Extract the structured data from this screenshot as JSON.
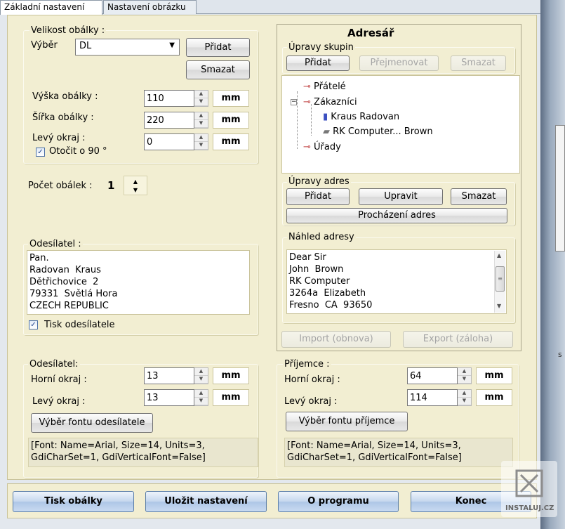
{
  "tabs": {
    "basic": "Základní nastavení",
    "image": "Nastavení obrázku"
  },
  "envelope_size": {
    "group_title": "Velikost obálky :",
    "select_label": "Výběr",
    "select_value": "DL",
    "add_button": "Přidat",
    "delete_button": "Smazat",
    "height_label": "Výška obálky :",
    "height_value": "110",
    "width_label": "Šířka obálky :",
    "width_value": "220",
    "left_margin_label": "Levý okraj :",
    "left_margin_value": "0",
    "unit": "mm",
    "rotate_label": "Otočit o 90 °"
  },
  "count": {
    "label": "Počet obálek :",
    "value": "1"
  },
  "sender": {
    "group_title": "Odesílatel :",
    "lines": "Pan.\nRadovan  Kraus\nDětřichovice  2\n79331  Světlá Hora\nCZECH REPUBLIC",
    "print_label": "Tisk odesílatele"
  },
  "address_book": {
    "title": "Adresář",
    "groups_title": "Úpravy skupin",
    "groups_add": "Přidat",
    "groups_rename": "Přejmenovat",
    "groups_delete": "Smazat",
    "tree": {
      "friends": "Přátelé",
      "customers": "Zákazníci",
      "contact1": "Kraus Radovan",
      "contact2": "RK Computer... Brown",
      "offices": "Úřady"
    },
    "addresses_title": "Úpravy adres",
    "addr_add": "Přidat",
    "addr_edit": "Upravit",
    "addr_delete": "Smazat",
    "browse": "Procházení adres",
    "preview_title": "Náhled adresy",
    "preview_text": "Dear Sir\nJohn  Brown\nRK Computer\n3264a  Elizabeth\nFresno  CA  93650",
    "import": "Import (obnova)",
    "export": "Export (záloha)"
  },
  "sender_font": {
    "group_title": "Odesílatel:",
    "top_label": "Horní okraj :",
    "top_value": "13",
    "left_label": "Levý okraj :",
    "left_value": "13",
    "unit": "mm",
    "font_button": "Výběr fontu odesílatele",
    "font_info": "[Font: Name=Arial, Size=14, Units=3,\nGdiCharSet=1, GdiVerticalFont=False]"
  },
  "recipient_font": {
    "group_title": "Příjemce :",
    "top_label": "Horní okraj :",
    "top_value": "64",
    "left_label": "Levý okraj :",
    "left_value": "114",
    "unit": "mm",
    "font_button": "Výběr fontu příjemce",
    "font_info": "[Font: Name=Arial, Size=14, Units=3,\nGdiCharSet=1, GdiVerticalFont=False]"
  },
  "bottom": {
    "print": "Tisk obálky",
    "save": "Uložit nastavení",
    "about": "O programu",
    "end": "Konec"
  },
  "watermark": "INSTALUJ.CZ",
  "edge_text": "s",
  "colors": {
    "panel": "#f2eed2",
    "button_blue": "#c5d7ee",
    "window_edge": "#5d6d84"
  }
}
